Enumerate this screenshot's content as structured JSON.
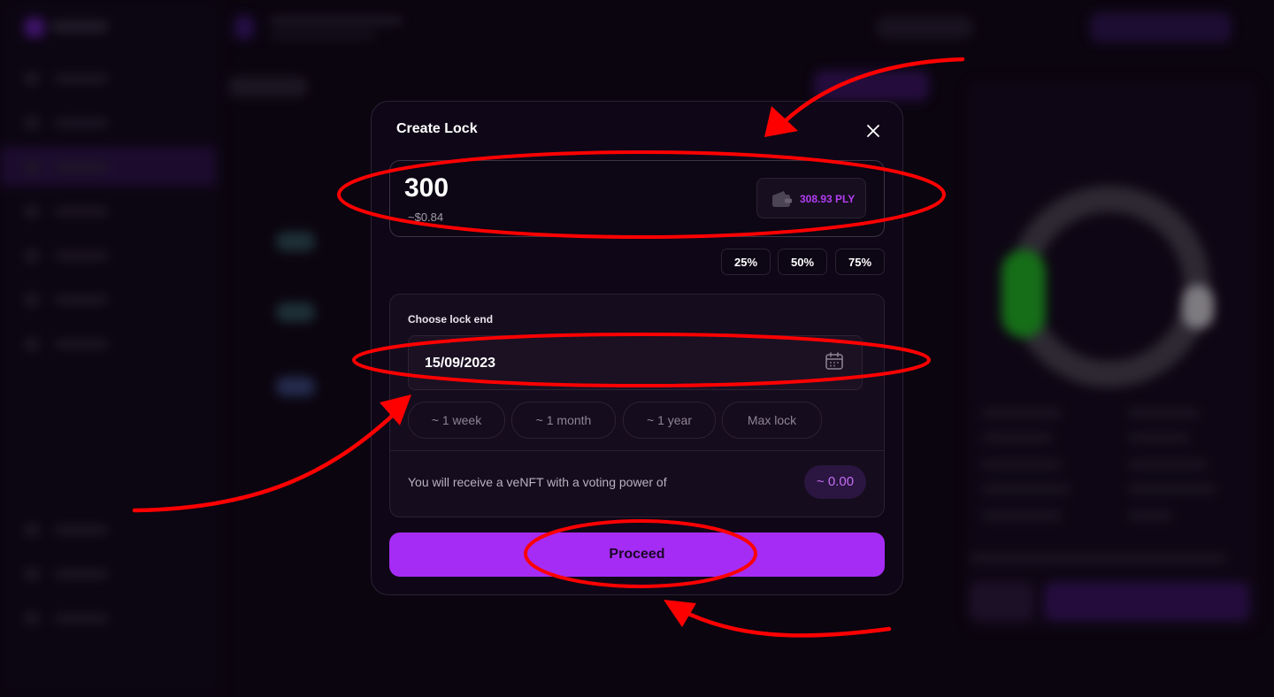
{
  "modal": {
    "title": "Create Lock",
    "amount": {
      "value": "300",
      "usd_value": "~$0.84",
      "balance": "308.93 PLY"
    },
    "percent_options": [
      "25%",
      "50%",
      "75%"
    ],
    "lock_end": {
      "label": "Choose lock end",
      "date": "15/09/2023",
      "durations": [
        "~ 1 week",
        "~ 1 month",
        "~ 1 year",
        "Max lock"
      ]
    },
    "voting_power": {
      "text": "You will receive a veNFT with a voting power of",
      "value": "~ 0.00"
    },
    "proceed_label": "Proceed"
  },
  "icons": {
    "close": "close-icon",
    "wallet": "wallet-icon",
    "calendar": "calendar-icon"
  },
  "colors": {
    "accent": "#a52cf5",
    "balance": "#b23ef0",
    "annotation": "#ff0000",
    "modal_bg": "#0f0717",
    "page_bg": "#0b0510"
  }
}
